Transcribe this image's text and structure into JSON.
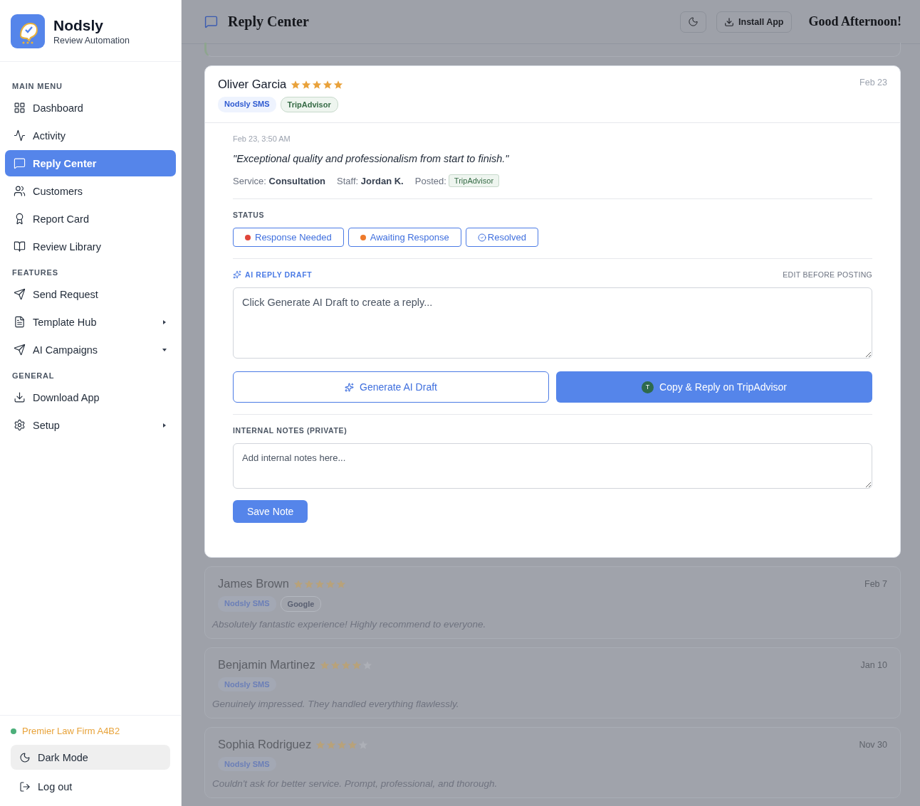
{
  "brand": {
    "name": "Nodsly",
    "tagline": "Review Automation"
  },
  "sidebar": {
    "sections": [
      {
        "title": "MAIN MENU",
        "items": [
          {
            "label": "Dashboard",
            "kind": "link",
            "selected": false
          },
          {
            "label": "Activity",
            "kind": "link",
            "selected": false
          },
          {
            "label": "Reply Center",
            "kind": "link",
            "selected": true
          },
          {
            "label": "Customers",
            "kind": "link",
            "selected": false
          },
          {
            "label": "Report Card",
            "kind": "link",
            "selected": false
          },
          {
            "label": "Review Library",
            "kind": "link",
            "selected": false
          }
        ]
      },
      {
        "title": "FEATURES",
        "items": [
          {
            "label": "Send Request",
            "kind": "link",
            "selected": false
          },
          {
            "label": "Template Hub",
            "kind": "submenu",
            "selected": false,
            "expanded": false
          },
          {
            "label": "AI Campaigns",
            "kind": "submenu",
            "selected": false,
            "expanded": true
          }
        ]
      },
      {
        "title": "GENERAL",
        "items": [
          {
            "label": "Download App",
            "kind": "link",
            "selected": false
          },
          {
            "label": "Setup",
            "kind": "submenu",
            "selected": false,
            "expanded": false
          }
        ]
      }
    ],
    "account": {
      "name": "Premier Law Firm A4B2",
      "color": "#4caf7a"
    },
    "dark_mode": "Dark Mode",
    "logout": "Log out"
  },
  "header": {
    "title": "Reply Center",
    "install": "Install App",
    "greeting": "Good Afternoon!"
  },
  "open_review": {
    "name": "Oliver Garcia",
    "stars": 5,
    "date": "Feb 23",
    "tags": [
      {
        "label": "Nodsly SMS",
        "kind": "sms"
      },
      {
        "label": "TripAdvisor",
        "kind": "platform"
      }
    ],
    "timestamp": "Feb 23, 3:50 AM",
    "quote": "\"Exceptional quality and professionalism from start to finish.\"",
    "meta": [
      {
        "label": "Service:",
        "value": "Consultation"
      },
      {
        "label": "Staff:",
        "value": "Jordan K."
      }
    ],
    "posted_label": "Posted:",
    "posted": "TripAdvisor",
    "status_title": "STATUS",
    "statuses": [
      {
        "label": "Response Needed",
        "kind": "dot",
        "color": "#e0463a",
        "selected": false
      },
      {
        "label": "Awaiting Response",
        "kind": "dot",
        "color": "#ee7a2b",
        "selected": false
      },
      {
        "label": "Resolved",
        "kind": "check",
        "selected": false
      }
    ],
    "draft_title": "AI REPLY DRAFT",
    "draft_hint": "EDIT BEFORE POSTING",
    "draft_placeholder": "Click Generate AI Draft to create a reply...",
    "generate": "Generate AI Draft",
    "copy_badge": "T",
    "copy": "Copy & Reply on TripAdvisor",
    "notes_title": "INTERNAL NOTES (PRIVATE)",
    "notes_placeholder": "Add internal notes here...",
    "save": "Save Note"
  },
  "reviews": [
    {
      "name": "James Brown",
      "stars": 5,
      "date": "Feb 7",
      "tags": [
        "Nodsly SMS",
        "Google"
      ],
      "text": "Absolutely fantastic experience! Highly recommend to everyone."
    },
    {
      "name": "Benjamin Martinez",
      "stars": 4,
      "date": "Jan 10",
      "tags": [
        "Nodsly SMS"
      ],
      "text": "Genuinely impressed. They handled everything flawlessly."
    },
    {
      "name": "Sophia Rodriguez",
      "stars": 4,
      "date": "Nov 30",
      "tags": [
        "Nodsly SMS"
      ],
      "text": "Couldn't ask for better service. Prompt, professional, and thorough."
    }
  ]
}
